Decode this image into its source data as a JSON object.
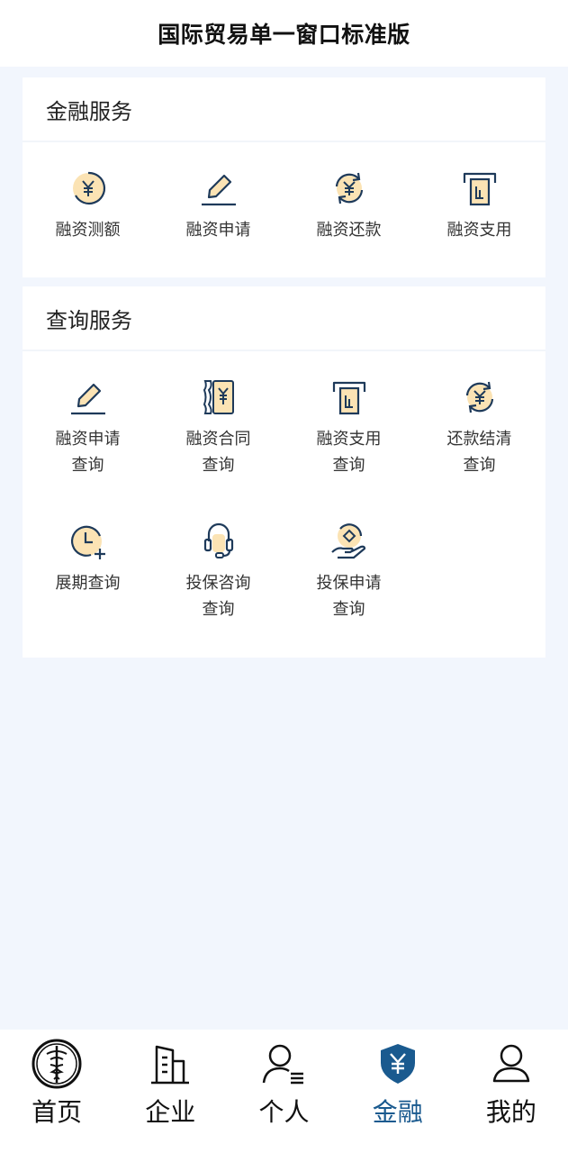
{
  "header": {
    "title": "国际贸易单一窗口标准版"
  },
  "finance": {
    "title": "金融服务",
    "items": [
      {
        "label": "融资测额",
        "label2": "",
        "icon": "yen-coin-icon"
      },
      {
        "label": "融资申请",
        "label2": "",
        "icon": "pencil-icon"
      },
      {
        "label": "融资还款",
        "label2": "",
        "icon": "yen-cycle-icon"
      },
      {
        "label": "融资支用",
        "label2": "",
        "icon": "withdraw-card-icon"
      }
    ]
  },
  "query": {
    "title": "查询服务",
    "items": [
      {
        "label": "融资申请",
        "label2": "查询",
        "icon": "pencil-icon"
      },
      {
        "label": "融资合同",
        "label2": "查询",
        "icon": "contract-yen-icon"
      },
      {
        "label": "融资支用",
        "label2": "查询",
        "icon": "withdraw-card-icon"
      },
      {
        "label": "还款结清",
        "label2": "查询",
        "icon": "yen-cycle-icon"
      },
      {
        "label": "展期查询",
        "label2": "",
        "icon": "clock-plus-icon"
      },
      {
        "label": "投保咨询",
        "label2": "查询",
        "icon": "headset-icon"
      },
      {
        "label": "投保申请",
        "label2": "查询",
        "icon": "hand-diamond-icon"
      }
    ]
  },
  "tabbar": {
    "items": [
      {
        "label": "首页",
        "icon": "customs-emblem-icon",
        "active": false
      },
      {
        "label": "企业",
        "icon": "building-icon",
        "active": false
      },
      {
        "label": "个人",
        "icon": "person-list-icon",
        "active": false
      },
      {
        "label": "金融",
        "icon": "yen-shield-icon",
        "active": true
      },
      {
        "label": "我的",
        "icon": "user-icon",
        "active": false
      }
    ]
  },
  "colors": {
    "accent": "#1a5a8f",
    "icon_stroke": "#1e3a5a",
    "icon_fill": "#fbe3b4",
    "background": "#f2f6fd"
  }
}
